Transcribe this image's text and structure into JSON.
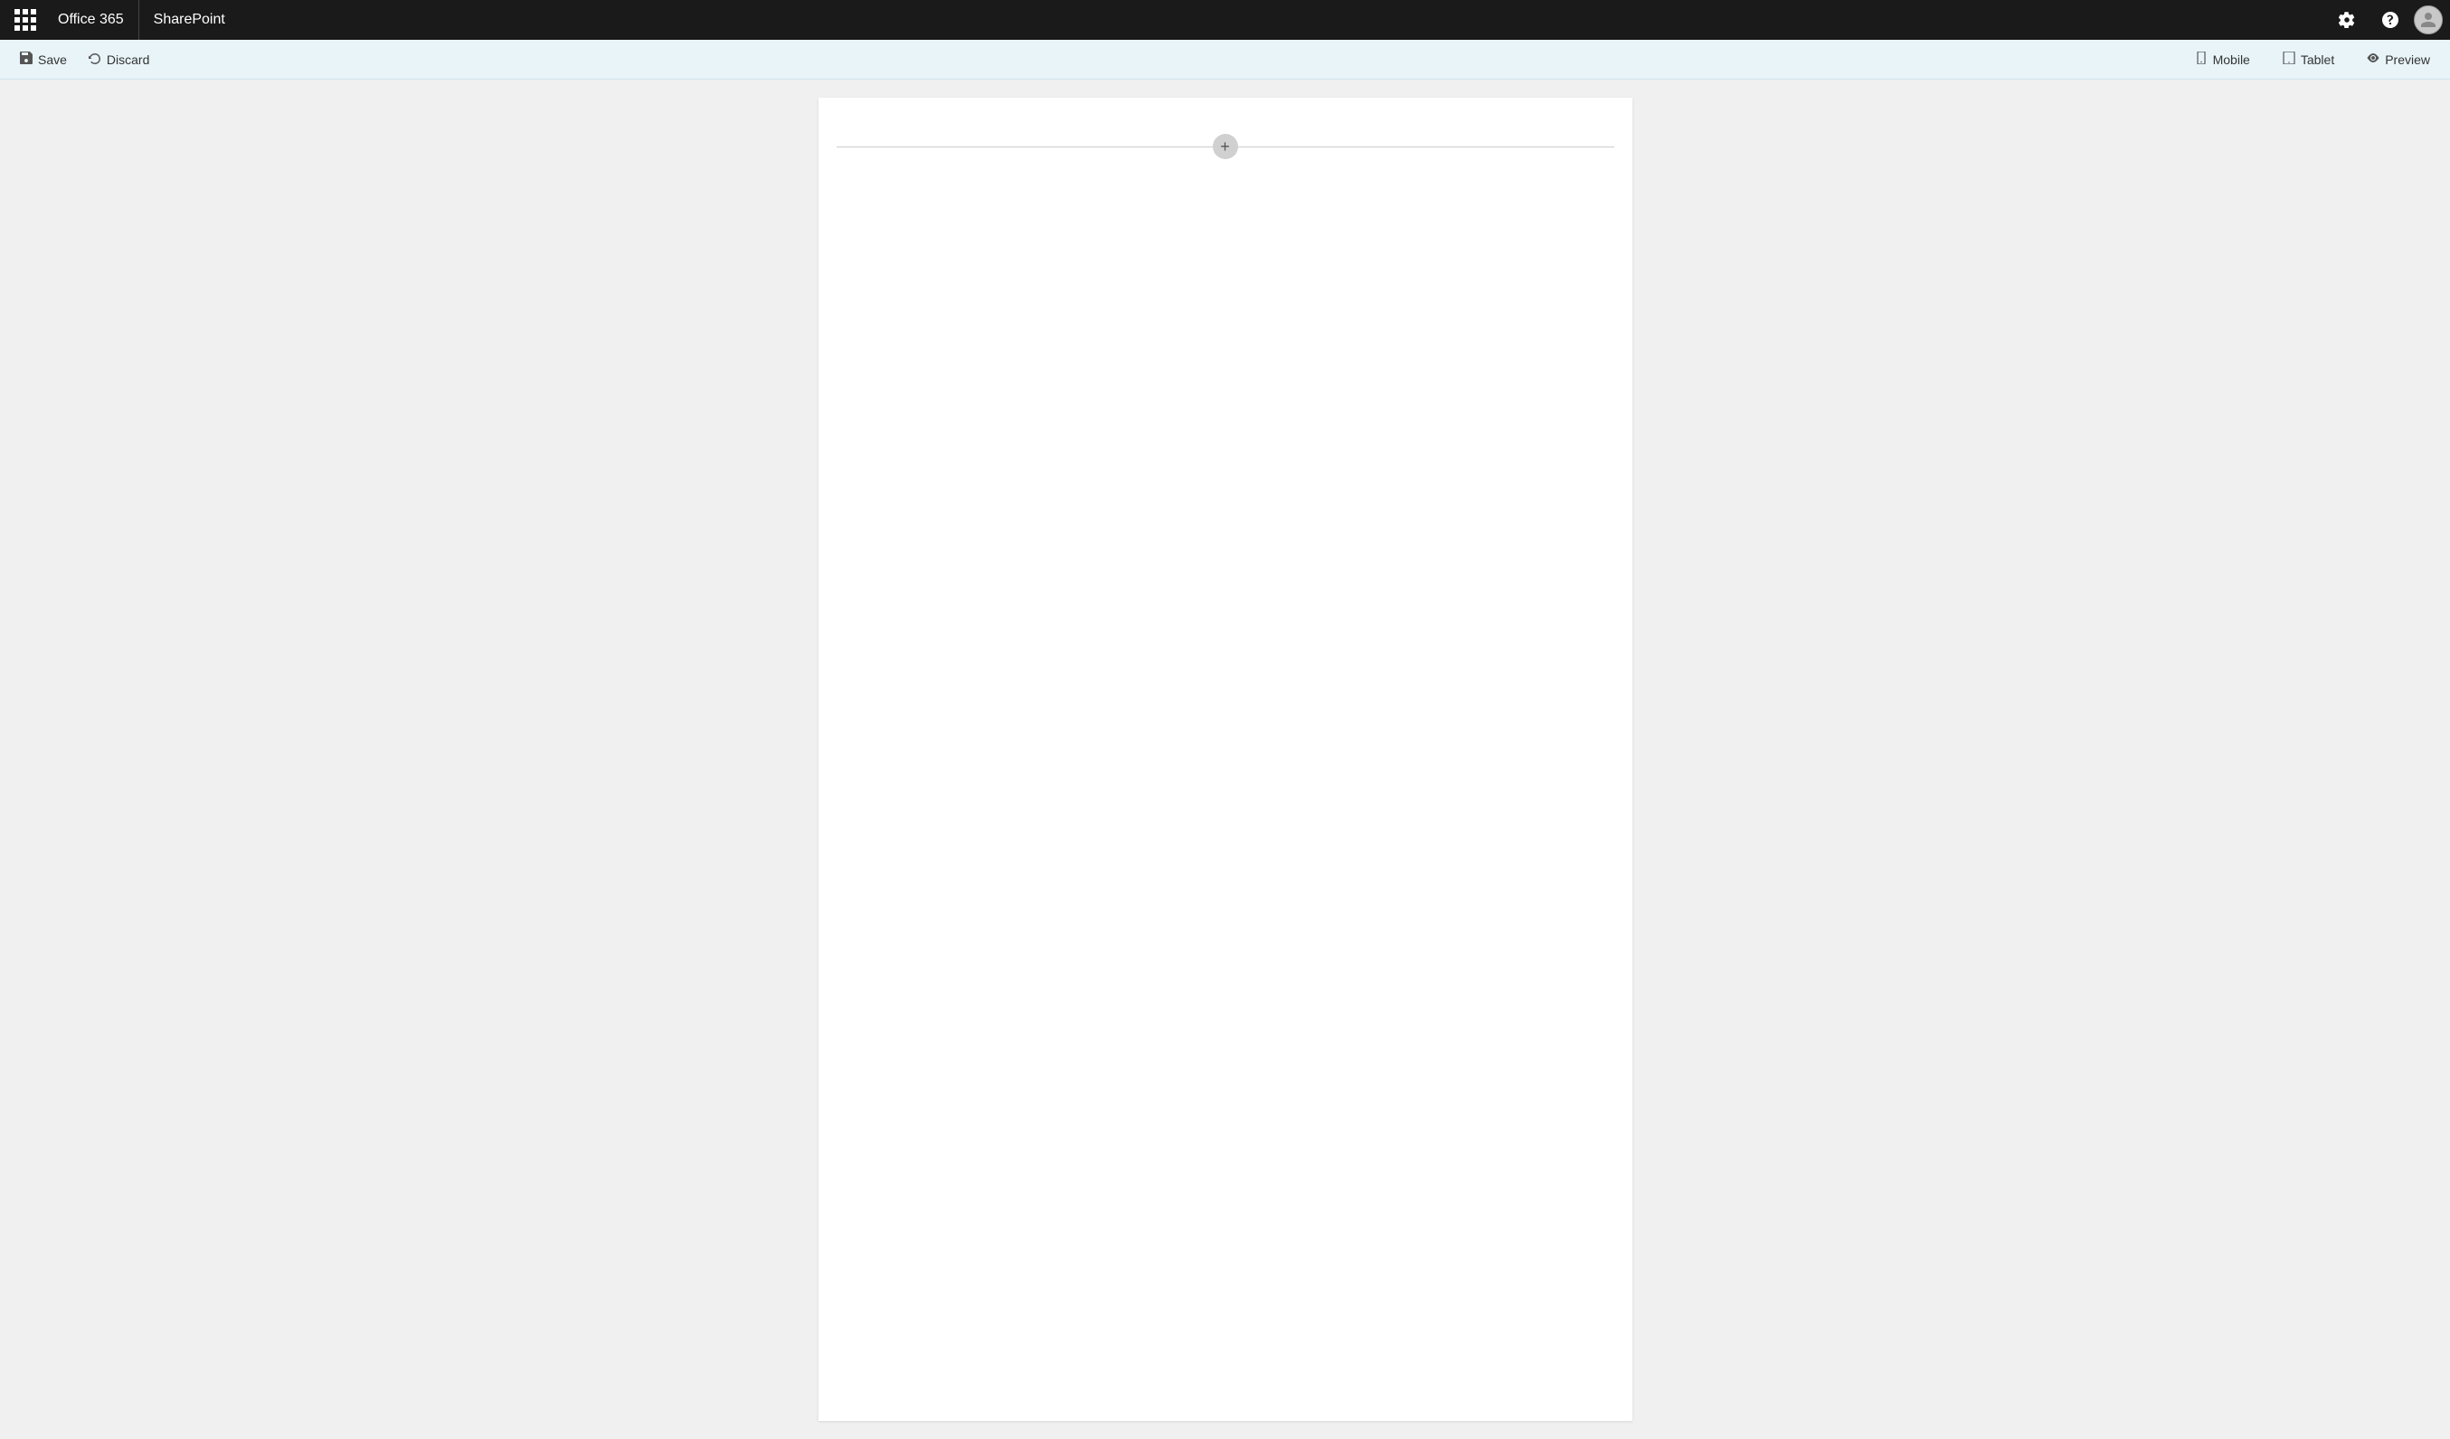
{
  "nav": {
    "apps_icon_label": "Apps",
    "office_label": "Office 365",
    "app_label": "SharePoint",
    "settings_icon": "settings-icon",
    "help_icon": "help-icon",
    "avatar_icon": "user-avatar"
  },
  "toolbar": {
    "save_label": "Save",
    "discard_label": "Discard",
    "mobile_label": "Mobile",
    "tablet_label": "Tablet",
    "preview_label": "Preview"
  },
  "canvas": {
    "add_section_label": "Add a new section"
  }
}
